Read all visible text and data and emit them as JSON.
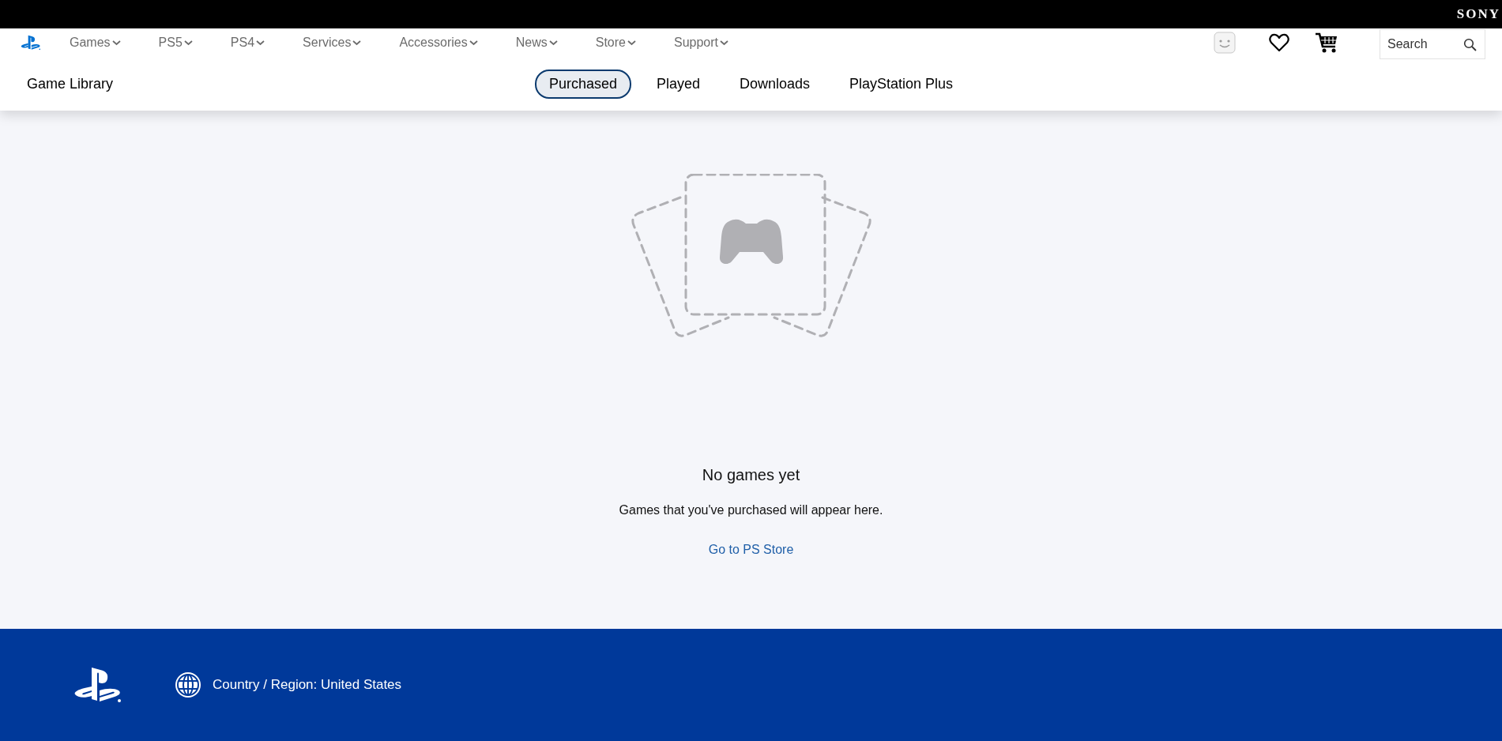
{
  "top_bar": {
    "brand": "SONY"
  },
  "nav": {
    "items": [
      {
        "label": "Games"
      },
      {
        "label": "PS5"
      },
      {
        "label": "PS4"
      },
      {
        "label": "Services"
      },
      {
        "label": "Accessories"
      },
      {
        "label": "News"
      },
      {
        "label": "Store"
      },
      {
        "label": "Support"
      }
    ],
    "search": {
      "placeholder": "Search"
    }
  },
  "library": {
    "title": "Game Library",
    "tabs": [
      {
        "label": "Purchased",
        "selected": true
      },
      {
        "label": "Played",
        "selected": false
      },
      {
        "label": "Downloads",
        "selected": false
      },
      {
        "label": "PlayStation Plus",
        "selected": false
      }
    ]
  },
  "empty_state": {
    "heading": "No games yet",
    "message": "Games that you've purchased will appear here.",
    "link": "Go to PS Store"
  },
  "footer": {
    "region": "Country / Region: United States"
  }
}
